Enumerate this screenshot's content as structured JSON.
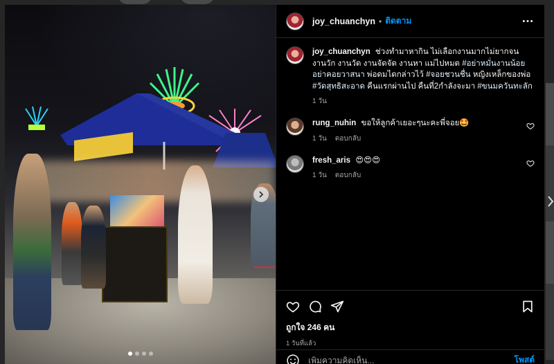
{
  "post": {
    "username": "joy_chuanchyn",
    "follow_label": "ติดตาม",
    "separator": "•"
  },
  "caption": {
    "username": "joy_chuanchyn",
    "text_plain": "ช่วงทำมาหากิน ไม่เลือกงานมากไม่ยากจน งานวัก งานวัด งานจัดจัด งานหา แม่ไปหมด",
    "tag1": "#อย่าหมั่นงานน้อยอย่าคอยวาสนา",
    "text_mid": "พ่อดมไดกล่าวไว้",
    "tag2": "#จอยชวนชื่น",
    "text_mid2": "หญิงเหล็กของพ่อ",
    "tag3": "#วัดสุทธิสะอาด",
    "text_mid3": "คืนแรกผ่านไป คืนที่2กำลังจะมา",
    "tag4": "#ขนมควันทะลัก",
    "time": "1 วัน"
  },
  "comments": [
    {
      "username": "rung_nuhin",
      "text": "ขอให้ลูกค้าเยอะๆนะคะพี่จอย🤩",
      "time": "1 วัน",
      "reply_label": "ตอบกลับ"
    },
    {
      "username": "fresh_aris",
      "text": "😍😍😍",
      "time": "1 วัน",
      "reply_label": "ตอบกลับ"
    }
  ],
  "stats": {
    "likes": "ถูกใจ 246 คน",
    "time_ago": "1 วันที่แล้ว"
  },
  "composer": {
    "placeholder": "เพิ่มความคิดเห็น...",
    "post_label": "โพสต์"
  },
  "icons": {
    "more": "more-horizontal-icon",
    "like": "heart-icon",
    "comment": "comment-icon",
    "share": "send-icon",
    "save": "bookmark-icon",
    "emoji": "emoji-icon",
    "next": "chevron-right-icon"
  },
  "colors": {
    "accent": "#0095f6",
    "panel_bg": "#000000",
    "muted_text": "#a8a8a8"
  },
  "carousel": {
    "total": 4,
    "current": 1
  }
}
